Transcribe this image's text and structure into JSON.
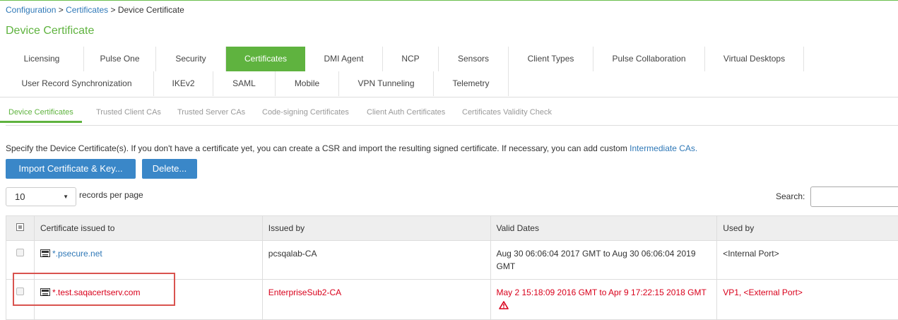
{
  "breadcrumb": {
    "items": [
      "Configuration",
      "Certificates"
    ],
    "current": "Device Certificate",
    "separator": ">"
  },
  "page": {
    "title": "Device Certificate"
  },
  "tabs": {
    "row1": [
      "Licensing",
      "Pulse One",
      "Security",
      "Certificates",
      "DMI Agent",
      "NCP",
      "Sensors",
      "Client Types",
      "Pulse Collaboration",
      "Virtual Desktops"
    ],
    "row2": [
      "User Record Synchronization",
      "IKEv2",
      "SAML",
      "Mobile",
      "VPN Tunneling",
      "Telemetry"
    ],
    "active": "Certificates"
  },
  "subtabs": {
    "items": [
      "Device Certificates",
      "Trusted Client CAs",
      "Trusted Server CAs",
      "Code-signing Certificates",
      "Client Auth Certificates",
      "Certificates Validity Check"
    ],
    "active": "Device Certificates"
  },
  "description": {
    "text": "Specify the Device Certificate(s). If you don't have a certificate yet, you can create a CSR and import the resulting signed certificate. If necessary, you can add custom",
    "link": "Intermediate CAs."
  },
  "buttons": {
    "import": "Import Certificate & Key...",
    "delete": "Delete..."
  },
  "pagination": {
    "page_size": "10",
    "records_label": "records per page",
    "search_label": "Search:",
    "search_value": ""
  },
  "table": {
    "headers": [
      "Certificate issued to",
      "Issued by",
      "Valid Dates",
      "Used by"
    ],
    "rows": [
      {
        "issued_to": "*.psecure.net",
        "issued_by": "pcsqalab-CA",
        "valid_dates": "Aug 30 06:06:04 2017 GMT to Aug 30 06:06:04 2019 GMT",
        "used_by": "<Internal Port>",
        "status": "ok"
      },
      {
        "issued_to": "*.test.saqacertserv.com",
        "issued_by": "EnterpriseSub2-CA",
        "valid_dates": "May 2 15:18:09 2016 GMT to Apr 9 17:22:15 2018 GMT",
        "used_by": "VP1, <External Port>",
        "status": "error"
      }
    ]
  },
  "colors": {
    "accent_green": "#5fb33f",
    "button_blue": "#3a87c8",
    "link_blue": "#2f78b7",
    "error_red": "#d9001b",
    "highlight_red": "#d9534f"
  },
  "icons": {
    "certificate": "certificate-icon",
    "warning": "warning-triangle-icon",
    "dropdown": "caret-down-icon"
  }
}
